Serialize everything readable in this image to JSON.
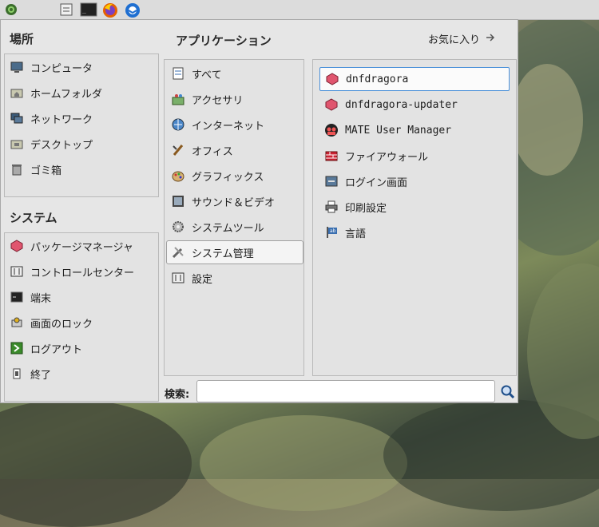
{
  "places": {
    "heading": "場所",
    "items": [
      {
        "label": "コンピュータ",
        "icon": "computer-icon"
      },
      {
        "label": "ホームフォルダ",
        "icon": "home-folder-icon"
      },
      {
        "label": "ネットワーク",
        "icon": "network-icon"
      },
      {
        "label": "デスクトップ",
        "icon": "desktop-icon"
      },
      {
        "label": "ゴミ箱",
        "icon": "trash-icon"
      }
    ]
  },
  "system": {
    "heading": "システム",
    "items": [
      {
        "label": "パッケージマネージャ",
        "icon": "package-manager-icon"
      },
      {
        "label": "コントロールセンター",
        "icon": "control-center-icon"
      },
      {
        "label": "端末",
        "icon": "terminal-icon"
      },
      {
        "label": "画面のロック",
        "icon": "lock-screen-icon"
      },
      {
        "label": "ログアウト",
        "icon": "logout-icon"
      },
      {
        "label": "終了",
        "icon": "shutdown-icon"
      }
    ]
  },
  "applications": {
    "heading": "アプリケーション",
    "favorites_label": "お気に入り",
    "categories": [
      {
        "label": "すべて",
        "icon": "all-icon"
      },
      {
        "label": "アクセサリ",
        "icon": "accessories-icon"
      },
      {
        "label": "インターネット",
        "icon": "internet-icon"
      },
      {
        "label": "オフィス",
        "icon": "office-icon"
      },
      {
        "label": "グラフィックス",
        "icon": "graphics-icon"
      },
      {
        "label": "サウンド＆ビデオ",
        "icon": "sound-video-icon"
      },
      {
        "label": "システムツール",
        "icon": "system-tools-icon"
      },
      {
        "label": "システム管理",
        "icon": "administration-icon"
      },
      {
        "label": "設定",
        "icon": "preferences-icon"
      }
    ],
    "selected_category": "システム管理",
    "apps": [
      {
        "label": "dnfdragora",
        "icon": "dnfdragora-icon"
      },
      {
        "label": "dnfdragora-updater",
        "icon": "dnfdragora-updater-icon"
      },
      {
        "label": "MATE User Manager",
        "icon": "user-manager-icon"
      },
      {
        "label": "ファイアウォール",
        "icon": "firewall-icon"
      },
      {
        "label": "ログイン画面",
        "icon": "login-screen-icon"
      },
      {
        "label": "印刷設定",
        "icon": "printer-icon"
      },
      {
        "label": "言語",
        "icon": "language-icon"
      }
    ],
    "selected_app": "dnfdragora"
  },
  "search": {
    "label": "検索:",
    "value": "",
    "placeholder": ""
  },
  "panel": {
    "icons": [
      "mate-menu-icon",
      "file-manager-icon",
      "terminal-launcher-icon",
      "firefox-icon",
      "thunderbird-icon"
    ]
  }
}
